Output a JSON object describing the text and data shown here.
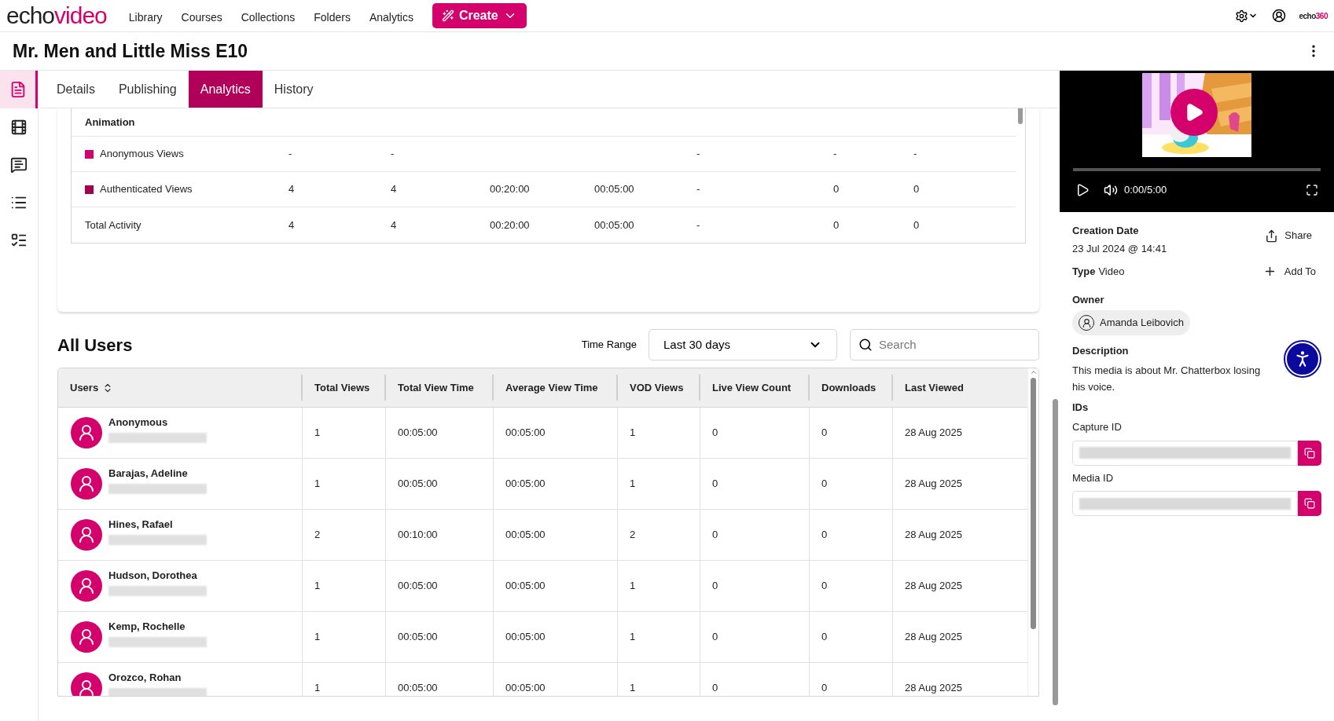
{
  "header": {
    "logo": {
      "dark": "echo",
      "accent": "video"
    },
    "nav": [
      "Library",
      "Courses",
      "Collections",
      "Folders",
      "Analytics"
    ],
    "create_button": "Create",
    "brand": {
      "dark": "echo",
      "accent": "360"
    }
  },
  "title": "Mr. Men and Little Miss E10",
  "rail": [
    {
      "kind": "details",
      "selected": true
    },
    {
      "kind": "film",
      "selected": false
    },
    {
      "kind": "captions",
      "selected": false
    },
    {
      "kind": "list",
      "selected": false
    },
    {
      "kind": "checklist",
      "selected": false
    }
  ],
  "tabs": [
    {
      "label": "Details",
      "selected": false
    },
    {
      "label": "Publishing",
      "selected": false
    },
    {
      "label": "Analytics",
      "selected": true
    },
    {
      "label": "History",
      "selected": false
    }
  ],
  "activity_table": {
    "section": "Animation",
    "rows": [
      {
        "kind": "series",
        "label": "Anonymous Views",
        "color": "#d4006b",
        "cells": [
          "-",
          "-",
          null,
          null,
          "-",
          "-",
          "-"
        ]
      },
      {
        "kind": "series",
        "label": "Authenticated Views",
        "color": "#a3004f",
        "cells": [
          "4",
          "4",
          "00:20:00",
          "00:05:00",
          "-",
          "0",
          "0"
        ]
      },
      {
        "kind": "total",
        "label": "Total Activity",
        "cells": [
          "4",
          "4",
          "00:20:00",
          "00:05:00",
          "-",
          "0",
          "0"
        ]
      }
    ]
  },
  "all_users": {
    "title": "All Users",
    "time_range_label": "Time Range",
    "time_range": "Last 30 days",
    "search_placeholder": "Search",
    "columns": [
      "Users",
      "Total Views",
      "Total View Time",
      "Average View Time",
      "VOD Views",
      "Live View Count",
      "Downloads",
      "Last Viewed"
    ],
    "rows": [
      {
        "cells": [
          "Anonymous",
          "1",
          "00:05:00",
          "00:05:00",
          "1",
          "0",
          "0",
          "28 Aug 2025"
        ]
      },
      {
        "cells": [
          "Barajas, Adeline",
          "1",
          "00:05:00",
          "00:05:00",
          "1",
          "0",
          "0",
          "28 Aug 2025"
        ]
      },
      {
        "cells": [
          "Hines, Rafael",
          "2",
          "00:10:00",
          "00:05:00",
          "2",
          "0",
          "0",
          "28 Aug 2025"
        ]
      },
      {
        "cells": [
          "Hudson, Dorothea",
          "1",
          "00:05:00",
          "00:05:00",
          "1",
          "0",
          "0",
          "28 Aug 2025"
        ]
      },
      {
        "cells": [
          "Kemp, Rochelle",
          "1",
          "00:05:00",
          "00:05:00",
          "1",
          "0",
          "0",
          "28 Aug 2025"
        ]
      },
      {
        "cells": [
          "Orozco, Rohan",
          "1",
          "00:05:00",
          "00:05:00",
          "1",
          "0",
          "0",
          "28 Aug 2025"
        ]
      }
    ]
  },
  "player": {
    "time": "0:00/5:00",
    "level": 0
  },
  "details": {
    "creation_label": "Creation Date",
    "creation_value": "23 Jul 2024 @ 14:41",
    "share": "Share",
    "type_label": "Type",
    "type_value": "Video",
    "add_to": "Add To",
    "owner_label": "Owner",
    "owner": "Amanda Leibovich",
    "description_label": "Description",
    "description": "This media is about Mr. Chatterbox losing his voice.",
    "ids_label": "IDs",
    "capture_id_label": "Capture ID",
    "media_id_label": "Media ID"
  }
}
